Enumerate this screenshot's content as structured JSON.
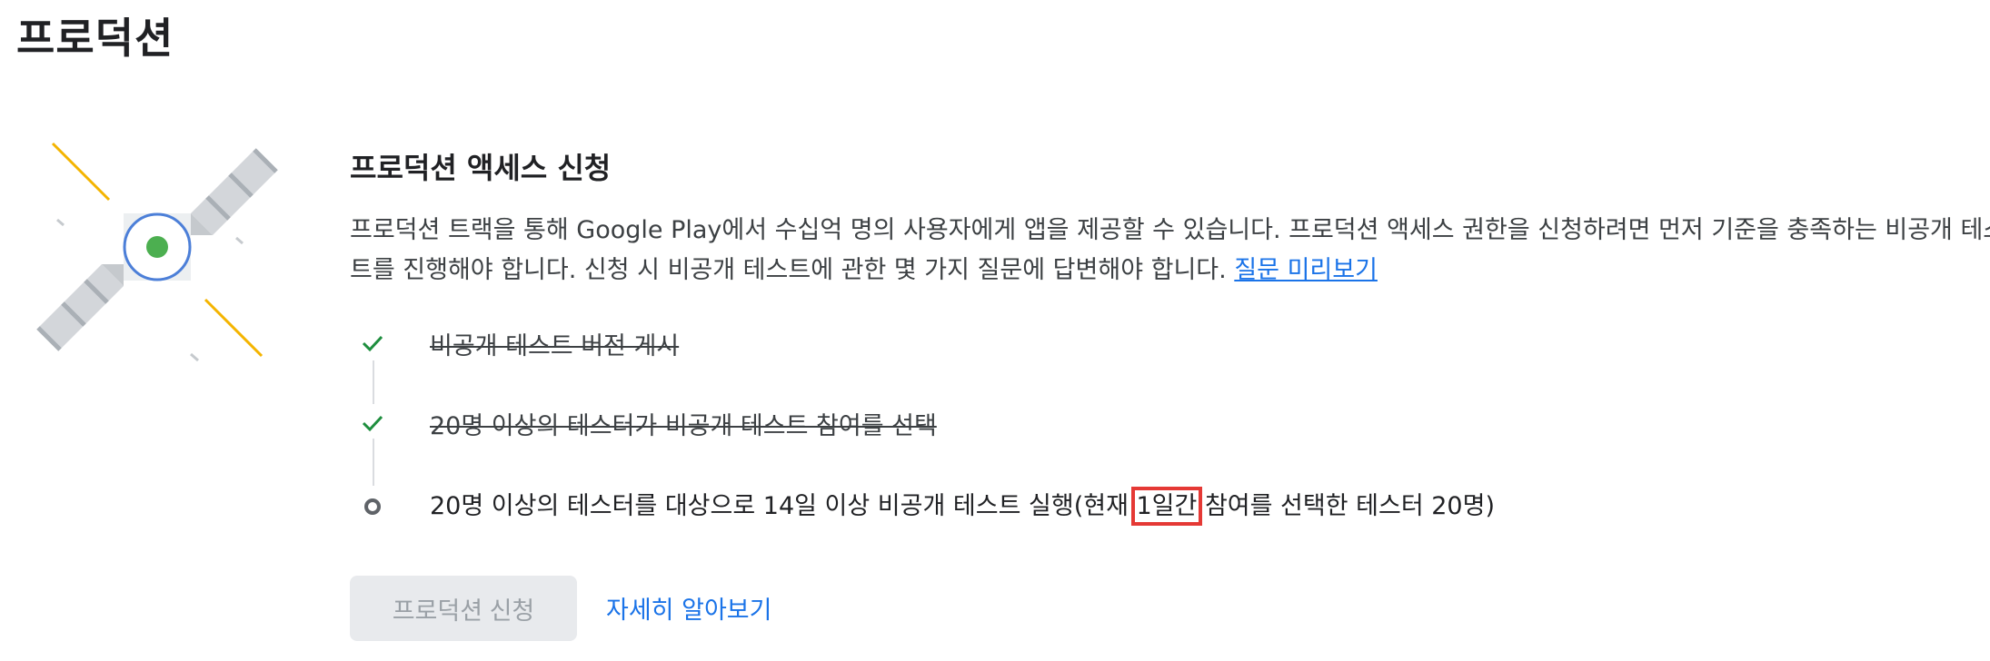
{
  "page": {
    "title": "프로덕션"
  },
  "section": {
    "title": "프로덕션 액세스 신청",
    "description_line1": "프로덕션 트랙을 통해 Google Play에서 수십억 명의 사용자에게 앱을 제공할 수 있습니다. 프로덕션 액세스 권한을 신청하려면 먼저 기준을 충족하는 비공개 테스",
    "description_line2": "트를 진행해야 합니다. 신청 시 비공개 테스트에 관한 몇 가지 질문에 답변해야 합니다.",
    "preview_link": "질문 미리보기"
  },
  "steps": [
    {
      "label": "비공개 테스트 버전 게시",
      "status": "done",
      "icon": "check-icon"
    },
    {
      "label": "20명 이상의 테스터가 비공개 테스트 참여를 선택",
      "status": "done",
      "icon": "check-icon"
    },
    {
      "label_prefix": "20명 이상의 테스터를 대상으로 14일 이상 비공개 테스트 실행(현재 ",
      "label_highlight": "1일간",
      "label_suffix": " 참여를 선택한 테스터 20명)",
      "status": "in-progress",
      "icon": "circle-icon"
    }
  ],
  "buttons": {
    "apply": "프로덕션 신청",
    "learn_more": "자세히 알아보기"
  },
  "colors": {
    "accent": "#1a73e8",
    "check": "#1e8e3e",
    "highlight": "#e53935",
    "disabled_bg": "#e8eaed"
  }
}
